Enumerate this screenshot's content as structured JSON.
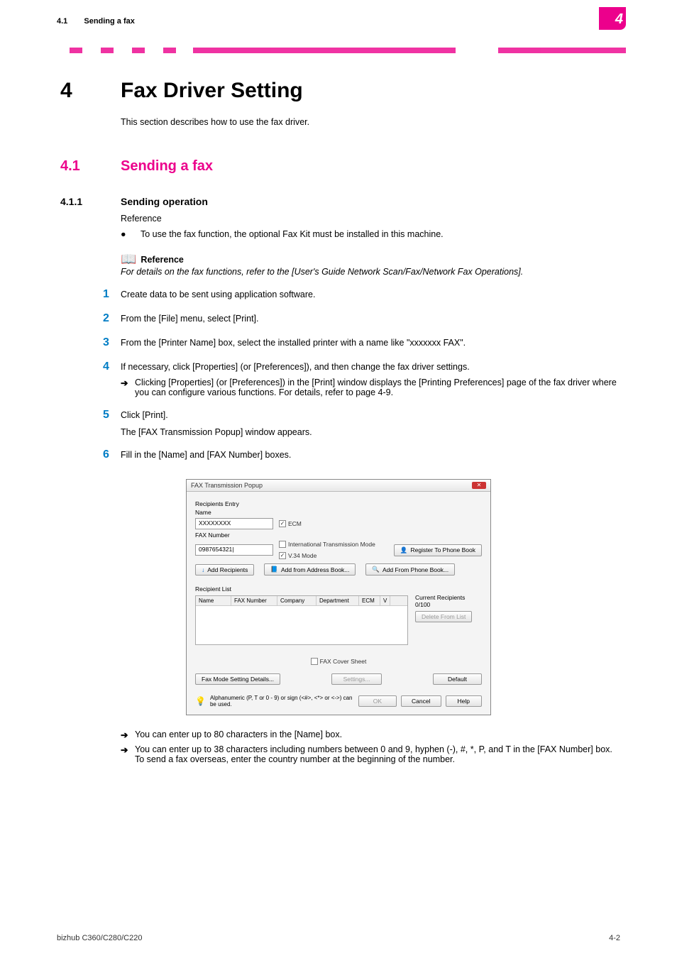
{
  "header": {
    "section_number": "4.1",
    "section_title": "Sending a fax",
    "chapter_badge": "4"
  },
  "chapter": {
    "number": "4",
    "title": "Fax Driver Setting",
    "intro": "This section describes how to use the fax driver."
  },
  "section": {
    "number": "4.1",
    "title": "Sending a fax"
  },
  "subsection": {
    "number": "4.1.1",
    "title": "Sending operation",
    "ref_label": "Reference",
    "bullet": "To use the fax function, the optional Fax Kit must be installed in this machine."
  },
  "reference_box": {
    "heading": "Reference",
    "body": "For details on the fax functions, refer to the [User's Guide Network Scan/Fax/Network Fax Operations]."
  },
  "steps": [
    {
      "n": "1",
      "text": "Create data to be sent using application software."
    },
    {
      "n": "2",
      "text": "From the [File] menu, select [Print]."
    },
    {
      "n": "3",
      "text": "From the [Printer Name] box, select the installed printer with a name like \"xxxxxxx FAX\"."
    },
    {
      "n": "4",
      "text": "If necessary, click [Properties] (or [Preferences]), and then change the fax driver settings.",
      "sub": "Clicking [Properties] (or [Preferences]) in the [Print] window displays the [Printing Preferences] page of the fax driver where you can configure various functions. For details, refer to page 4-9."
    },
    {
      "n": "5",
      "text": "Click [Print].",
      "after": "The [FAX Transmission Popup] window appears."
    },
    {
      "n": "6",
      "text": "Fill in the [Name] and [FAX Number] boxes."
    }
  ],
  "dialog": {
    "title": "FAX Transmission Popup",
    "group_label": "Recipients Entry",
    "name_label": "Name",
    "name_value": "XXXXXXXX",
    "ecm_label": "ECM",
    "faxnum_label": "FAX Number",
    "faxnum_value": "0987654321|",
    "intl_label": "International Transmission Mode",
    "v34_label": "V.34 Mode",
    "register_btn": "Register To Phone Book",
    "add_recipients_btn": "Add Recipients",
    "add_from_ab_btn": "Add from Address Book...",
    "add_from_pb_btn": "Add From Phone Book...",
    "recipient_list_label": "Recipient List",
    "cols": {
      "c1": "Name",
      "c2": "FAX Number",
      "c3": "Company",
      "c4": "Department",
      "c5": "ECM",
      "c6": "V"
    },
    "current_recipients": "Current Recipients 0/100",
    "delete_btn": "Delete From List",
    "cover_label": "FAX Cover Sheet",
    "settings_btn": "Settings...",
    "fax_mode_btn": "Fax Mode Setting Details...",
    "default_btn": "Default",
    "tip": "Alphanumeric (P, T or 0 - 9) or sign (<#>, <*> or <->) can be used.",
    "ok_btn": "OK",
    "cancel_btn": "Cancel",
    "help_btn": "Help"
  },
  "post_notes": {
    "a": "You can enter up to 80 characters in the [Name] box.",
    "b": "You can enter up to 38 characters including numbers between 0 and 9, hyphen (-), #, *, P, and T in the [FAX Number] box. To send a fax overseas, enter the country number at the beginning of the number."
  },
  "footer": {
    "left": "bizhub C360/C280/C220",
    "right": "4-2"
  },
  "glyphs": {
    "bullet": "●",
    "arrow": "➔",
    "book": "📖",
    "bulb": "💡",
    "down": "↓",
    "person": "👤",
    "search": "🔍"
  }
}
